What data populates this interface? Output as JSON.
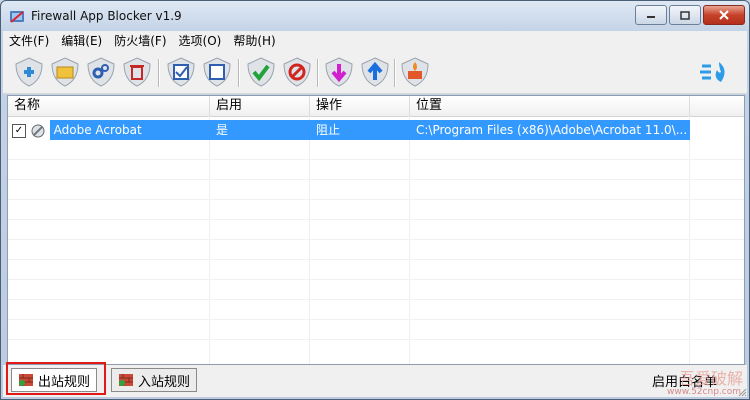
{
  "window": {
    "title": "Firewall App Blocker v1.9"
  },
  "menu": [
    "文件(F)",
    "编辑(E)",
    "防火墙(F)",
    "选项(O)",
    "帮助(H)"
  ],
  "toolbar": [
    "add-icon",
    "open-folder-icon",
    "gears-icon",
    "delete-icon",
    "check-box-icon",
    "uncheck-box-icon",
    "enable-check-icon",
    "block-icon",
    "move-down-icon",
    "move-up-icon",
    "firewall-icon",
    "speed-icon"
  ],
  "table": {
    "headers": [
      "名称",
      "启用",
      "操作",
      "位置"
    ],
    "rows": [
      {
        "checked": true,
        "name": "Adobe Acrobat",
        "enabled": "是",
        "action": "阻止",
        "location": "C:\\Program Files (x86)\\Adobe\\Acrobat 11.0\\..."
      }
    ]
  },
  "status": {
    "tabs": [
      {
        "label": "出站规则",
        "active": true
      },
      {
        "label": "入站规则",
        "active": false
      }
    ],
    "right_text": "启用白名单"
  },
  "watermark": {
    "line1": "吾爱破解",
    "line2": "www.52cnp.com"
  },
  "colors": {
    "selection": "#3399ff",
    "highlight_box": "#e01919"
  }
}
